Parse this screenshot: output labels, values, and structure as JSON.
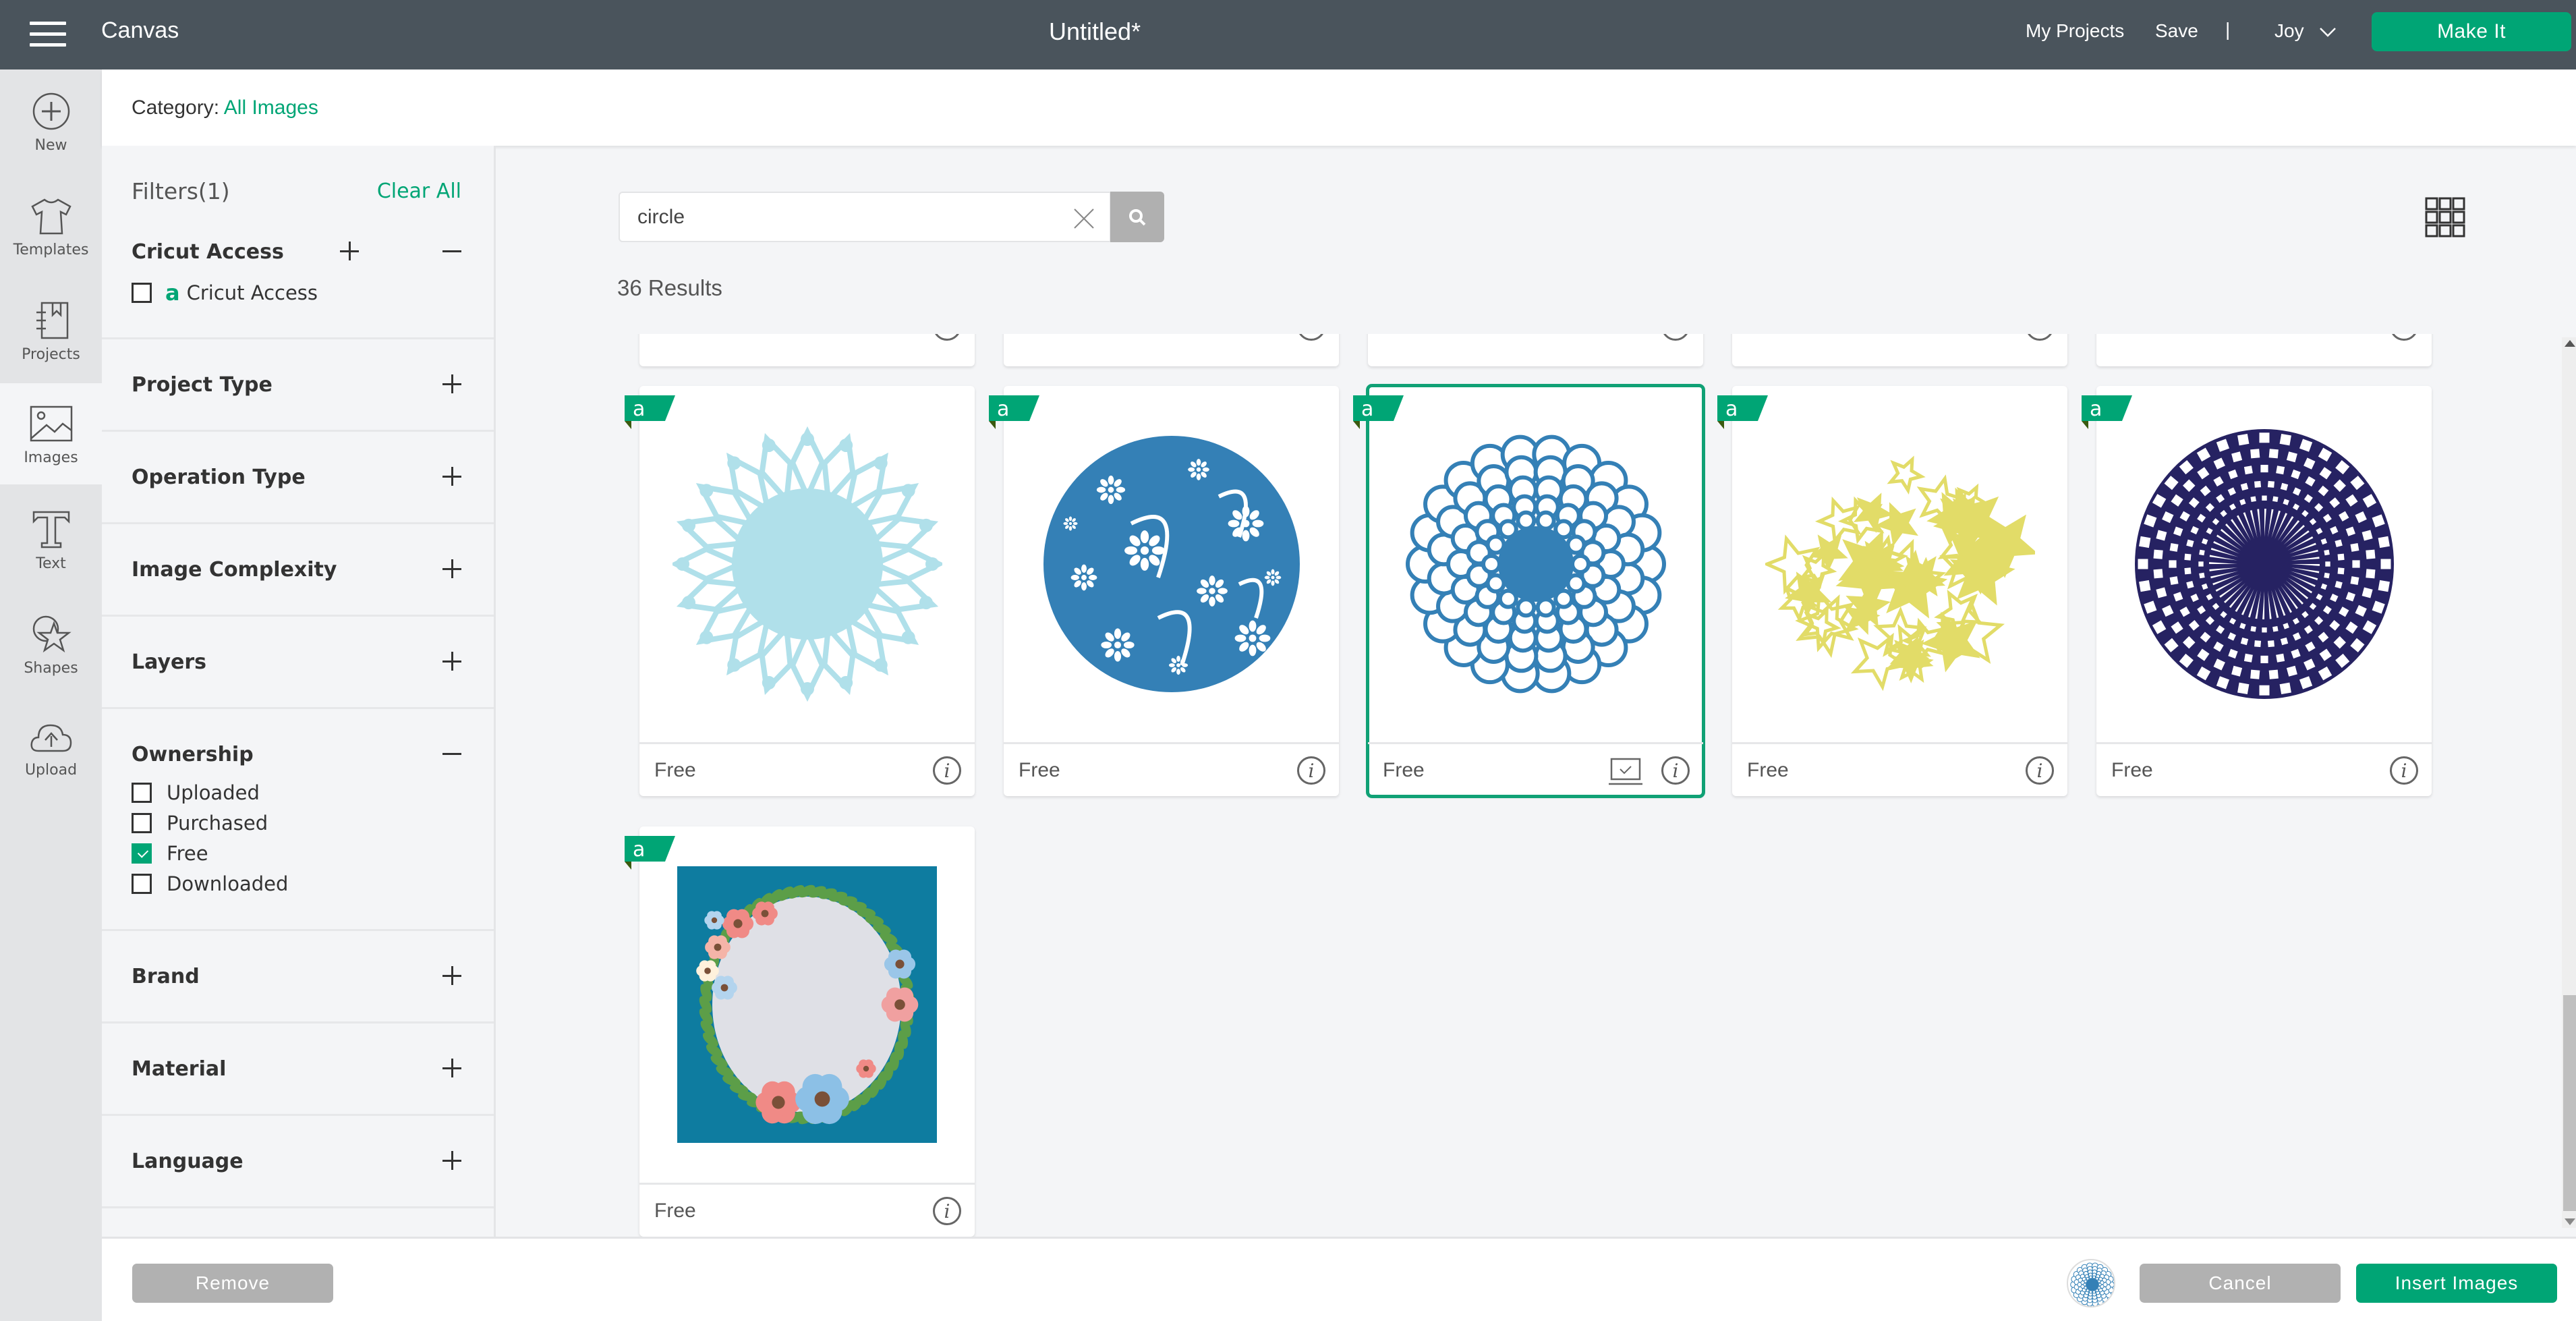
{
  "topbar": {
    "app_name": "Canvas",
    "doc_title": "Untitled*",
    "my_projects": "My Projects",
    "save": "Save",
    "divider": "|",
    "user": "Joy",
    "make_it": "Make It"
  },
  "rail": {
    "items": [
      {
        "label": "New",
        "icon": "plus-circle-icon"
      },
      {
        "label": "Templates",
        "icon": "tshirt-icon"
      },
      {
        "label": "Projects",
        "icon": "notebook-icon"
      },
      {
        "label": "Images",
        "icon": "image-icon",
        "active": true
      },
      {
        "label": "Text",
        "icon": "text-t-icon"
      },
      {
        "label": "Shapes",
        "icon": "shapes-icon"
      },
      {
        "label": "Upload",
        "icon": "cloud-upload-icon"
      }
    ]
  },
  "category": {
    "label": "Category:",
    "value": "All Images"
  },
  "filters": {
    "title": "Filters(1)",
    "clear_all": "Clear All",
    "cricut_access": {
      "title": "Cricut Access",
      "option": "Cricut Access",
      "checked": false
    },
    "sections": [
      {
        "title": "Project Type"
      },
      {
        "title": "Operation Type"
      },
      {
        "title": "Image Complexity"
      },
      {
        "title": "Layers"
      }
    ],
    "ownership": {
      "title": "Ownership",
      "options": [
        {
          "label": "Uploaded",
          "checked": false
        },
        {
          "label": "Purchased",
          "checked": false
        },
        {
          "label": "Free",
          "checked": true
        },
        {
          "label": "Downloaded",
          "checked": false
        }
      ]
    },
    "sections_bottom": [
      {
        "title": "Brand"
      },
      {
        "title": "Material"
      },
      {
        "title": "Language"
      }
    ]
  },
  "search": {
    "value": "circle",
    "placeholder": ""
  },
  "results": {
    "count_text": "36 Results"
  },
  "cards": [
    {
      "price": "Free",
      "image": "light blue lace doily circle",
      "color": "#b0e0ea",
      "selected": false
    },
    {
      "price": "Free",
      "image": "blue paisley floral circle",
      "color": "#3480b6",
      "selected": false
    },
    {
      "price": "Free",
      "image": "blue scalloped dahlia circle",
      "color": "#3480b6",
      "selected": true
    },
    {
      "price": "Free",
      "image": "yellow stars circle",
      "color": "#e2dc68",
      "selected": false
    },
    {
      "price": "Free",
      "image": "navy checkered radial circle",
      "color": "#262262",
      "selected": false
    },
    {
      "price": "Free",
      "image": "floral wreath on teal",
      "color": "#0e7ca0",
      "selected": false
    }
  ],
  "bottom": {
    "remove": "Remove",
    "cancel": "Cancel",
    "insert": "Insert Images"
  },
  "colors": {
    "accent": "#00a575",
    "topbar": "#4a545c",
    "disabled": "#b1b1b1"
  }
}
